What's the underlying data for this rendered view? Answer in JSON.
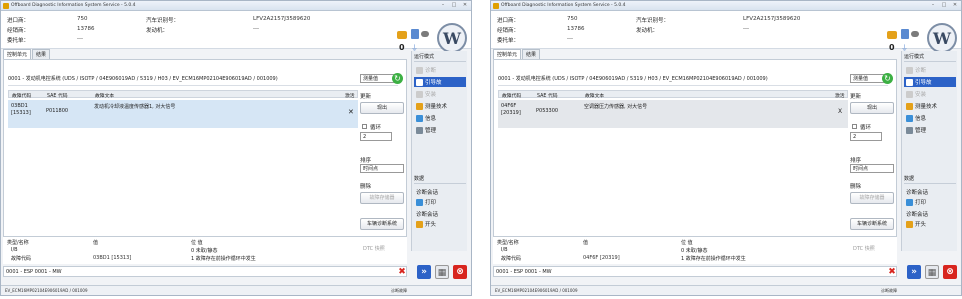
{
  "window_title": "Offboard Diagnostic Information System Service - 5.0.4",
  "controls": {
    "min": "–",
    "max": "□",
    "close": "✕"
  },
  "info": {
    "labels": [
      "进口商：",
      "经销商：",
      "委托单：",
      "汽车识别号：",
      "发动机："
    ],
    "importer": "750",
    "dealer": "13786",
    "order": "---",
    "vin": "LFV2A2157J3589620",
    "engine": "---"
  },
  "tabs": [
    "控制单元",
    "结果"
  ],
  "ecu_path": "0001 - 发动机电控系统  (UDS / ISOTP / 04E906019AD / 5319 / H03 / EV_ECM16MP02104E906019AD / 001009)",
  "filter_select": "测量值",
  "grid_headers": [
    "故障代码",
    "SAE 代码",
    "故障文本",
    "激活"
  ],
  "left_window": {
    "fault_code": "03BD1",
    "fault_code2": "[15313]",
    "sae": "P011800",
    "text": "发动机冷却液温度传感器1, 对大信号",
    "active": "✕",
    "detail_code": "03BD1 [15313]"
  },
  "right_window": {
    "fault_code": "04F6F",
    "fault_code2": "[20319]",
    "sae": "P053300",
    "text": "空调器压力传感器, 对大信号",
    "active": "X",
    "detail_code": "04F6F [20319]"
  },
  "right_panel": {
    "update": "更新",
    "show": "现出",
    "loop": "循环",
    "spin_value": "2",
    "sort": "排序",
    "sort_value": "时间点",
    "delete": "删除",
    "clear_button": "故障存储器",
    "vehicle_button": "车辆诊断系统"
  },
  "lower": {
    "col_type": "类型/名称",
    "col_value": "值",
    "row1_name": "I/B",
    "row2_name": "故障代码",
    "bits_header": "位  值",
    "bit0": "0   未取/静态",
    "bit1": "1   故障存在前操作循环中发生",
    "dtc": "DTC 快照"
  },
  "status_text": "0001 - ESP   0001 - MW",
  "footer_text": "EV_ECM16MP02104E906019AD / 001009",
  "footer_right": "诊断故障",
  "sidebar": {
    "mode": "运行模式",
    "items": [
      "诊断",
      "引导故",
      "安装",
      "测量技术",
      "信息",
      "管理"
    ],
    "data": "数据",
    "diag": "诊断会话",
    "print": "打印",
    "report": "诊断会话",
    "print2": "开头"
  },
  "colors": {
    "accent": "#2c62c7",
    "selected_row": "#d6e6f5",
    "red_x": "#d8251e"
  }
}
